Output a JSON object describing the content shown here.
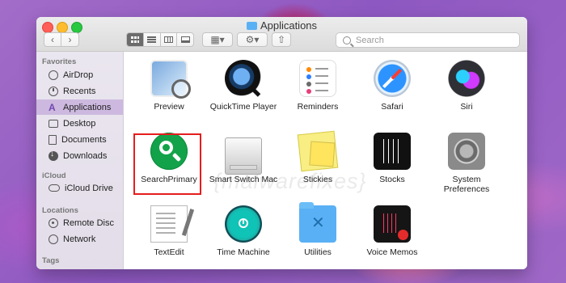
{
  "window": {
    "title": "Applications",
    "search_placeholder": "Search"
  },
  "toolbar": {
    "back_icon": "chevron-left-icon",
    "forward_icon": "chevron-right-icon"
  },
  "sidebar": {
    "sections": [
      {
        "label": "Favorites",
        "items": [
          "AirDrop",
          "Recents",
          "Applications",
          "Desktop",
          "Documents",
          "Downloads"
        ]
      },
      {
        "label": "iCloud",
        "items": [
          "iCloud Drive"
        ]
      },
      {
        "label": "Locations",
        "items": [
          "Remote Disc",
          "Network"
        ]
      },
      {
        "label": "Tags",
        "items": []
      }
    ]
  },
  "apps": [
    {
      "name": "Preview"
    },
    {
      "name": "QuickTime Player"
    },
    {
      "name": "Reminders"
    },
    {
      "name": "Safari"
    },
    {
      "name": "Siri"
    },
    {
      "name": "SearchPrimary"
    },
    {
      "name": "Smart Switch Mac"
    },
    {
      "name": "Stickies"
    },
    {
      "name": "Stocks"
    },
    {
      "name": "System Preferences"
    },
    {
      "name": "TextEdit"
    },
    {
      "name": "Time Machine"
    },
    {
      "name": "Utilities"
    },
    {
      "name": "Voice Memos"
    }
  ],
  "watermark": "{malwarefixes}"
}
